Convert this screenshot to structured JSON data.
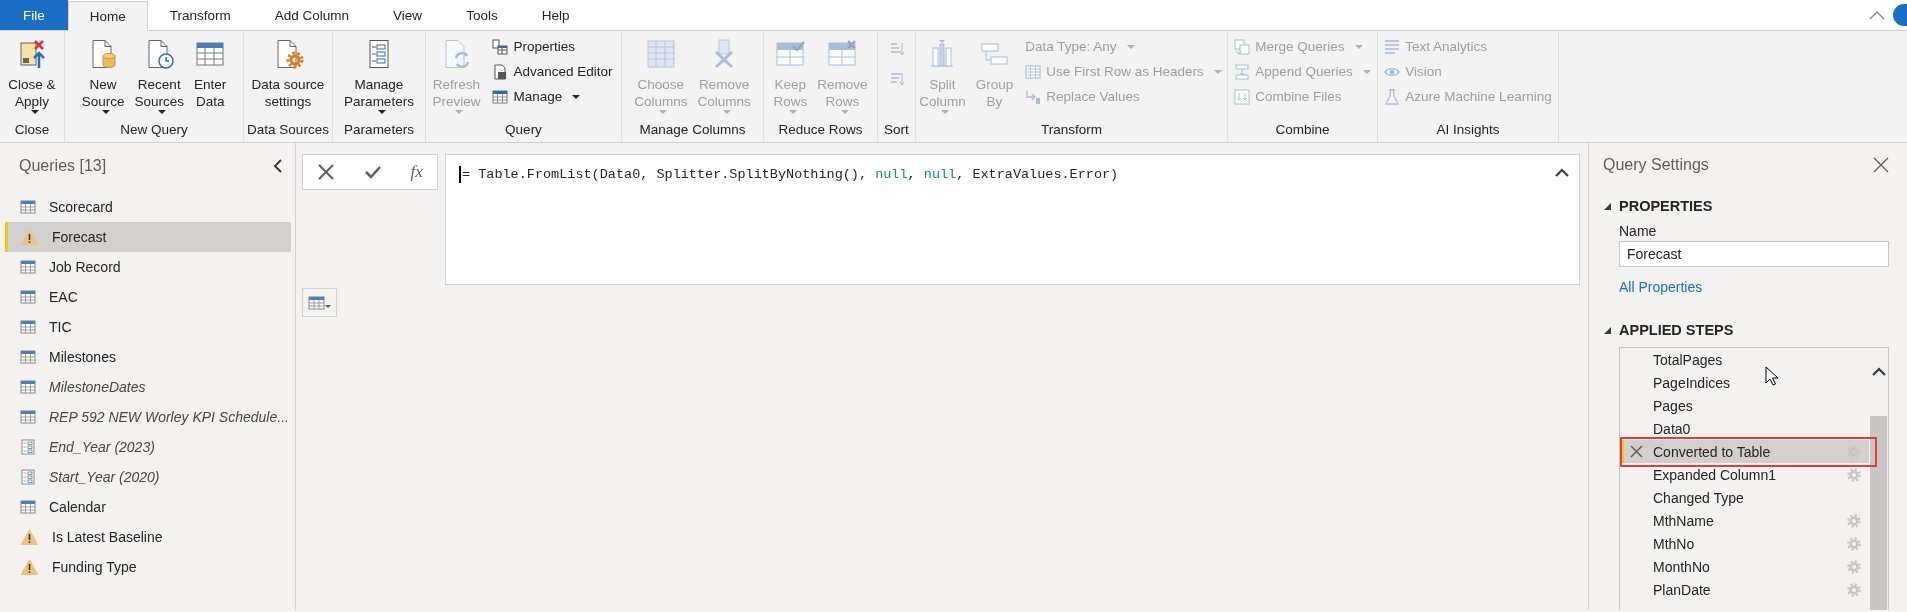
{
  "tabs": [
    {
      "label": "File",
      "kind": "file",
      "selected": false
    },
    {
      "label": "Home",
      "kind": "tab",
      "selected": true
    },
    {
      "label": "Transform",
      "kind": "tab",
      "selected": false
    },
    {
      "label": "Add Column",
      "kind": "tab",
      "selected": false
    },
    {
      "label": "View",
      "kind": "tab",
      "selected": false
    },
    {
      "label": "Tools",
      "kind": "tab",
      "selected": false
    },
    {
      "label": "Help",
      "kind": "tab",
      "selected": false
    }
  ],
  "ribbon": {
    "groups": [
      {
        "label": "Close",
        "items": [
          {
            "kind": "large",
            "label": "Close &\nApply",
            "dropdown": true,
            "disabled": false
          }
        ]
      },
      {
        "label": "New Query",
        "items": [
          {
            "kind": "large",
            "label": "New\nSource",
            "dropdown": true,
            "disabled": false
          },
          {
            "kind": "large",
            "label": "Recent\nSources",
            "dropdown": true,
            "disabled": false
          },
          {
            "kind": "large",
            "label": "Enter\nData",
            "dropdown": false,
            "disabled": false
          }
        ]
      },
      {
        "label": "Data Sources",
        "items": [
          {
            "kind": "large",
            "label": "Data source\nsettings",
            "dropdown": false,
            "disabled": false
          }
        ]
      },
      {
        "label": "Parameters",
        "items": [
          {
            "kind": "large",
            "label": "Manage\nParameters",
            "dropdown": true,
            "disabled": false
          }
        ]
      },
      {
        "label": "Query",
        "items": [
          {
            "kind": "large",
            "label": "Refresh\nPreview",
            "dropdown": true,
            "disabled": true
          },
          {
            "kind": "small",
            "label": "Properties",
            "dropdown": false,
            "disabled": false
          },
          {
            "kind": "small",
            "label": "Advanced Editor",
            "dropdown": false,
            "disabled": false
          },
          {
            "kind": "small",
            "label": "Manage",
            "dropdown": true,
            "disabled": false
          }
        ]
      },
      {
        "label": "Manage Columns",
        "items": [
          {
            "kind": "large",
            "label": "Choose\nColumns",
            "dropdown": true,
            "disabled": true
          },
          {
            "kind": "large",
            "label": "Remove\nColumns",
            "dropdown": true,
            "disabled": true
          }
        ]
      },
      {
        "label": "Reduce Rows",
        "items": [
          {
            "kind": "large",
            "label": "Keep\nRows",
            "dropdown": true,
            "disabled": true
          },
          {
            "kind": "large",
            "label": "Remove\nRows",
            "dropdown": true,
            "disabled": true
          }
        ]
      },
      {
        "label": "Sort",
        "items": [
          {
            "kind": "icon",
            "disabled": true
          },
          {
            "kind": "icon",
            "disabled": true
          }
        ]
      },
      {
        "label": "Transform",
        "items": [
          {
            "kind": "large",
            "label": "Split\nColumn",
            "dropdown": true,
            "disabled": true
          },
          {
            "kind": "large",
            "label": "Group\nBy",
            "dropdown": false,
            "disabled": true
          },
          {
            "kind": "small",
            "label": "Data Type: Any",
            "dropdown": true,
            "disabled": true
          },
          {
            "kind": "small",
            "label": "Use First Row as Headers",
            "dropdown": true,
            "disabled": true
          },
          {
            "kind": "small",
            "label": "Replace Values",
            "dropdown": false,
            "disabled": true
          }
        ]
      },
      {
        "label": "Combine",
        "items": [
          {
            "kind": "small",
            "label": "Merge Queries",
            "dropdown": true,
            "disabled": true
          },
          {
            "kind": "small",
            "label": "Append Queries",
            "dropdown": true,
            "disabled": true
          },
          {
            "kind": "small",
            "label": "Combine Files",
            "dropdown": false,
            "disabled": true
          }
        ]
      },
      {
        "label": "AI Insights",
        "items": [
          {
            "kind": "small",
            "label": "Text Analytics",
            "dropdown": false,
            "disabled": true
          },
          {
            "kind": "small",
            "label": "Vision",
            "dropdown": false,
            "disabled": true
          },
          {
            "kind": "small",
            "label": "Azure Machine Learning",
            "dropdown": false,
            "disabled": true
          }
        ]
      }
    ]
  },
  "queries": {
    "title": "Queries [13]",
    "items": [
      {
        "name": "Scorecard",
        "kind": "table",
        "loaded": true,
        "selected": false
      },
      {
        "name": "Forecast",
        "kind": "warning",
        "loaded": true,
        "selected": true
      },
      {
        "name": "Job Record",
        "kind": "table",
        "loaded": true,
        "selected": false
      },
      {
        "name": "EAC",
        "kind": "table",
        "loaded": true,
        "selected": false
      },
      {
        "name": "TIC",
        "kind": "table",
        "loaded": true,
        "selected": false
      },
      {
        "name": "Milestones",
        "kind": "table",
        "loaded": true,
        "selected": false
      },
      {
        "name": "MilestoneDates",
        "kind": "table",
        "loaded": false,
        "selected": false
      },
      {
        "name": "REP 592 NEW Worley KPI Schedule...",
        "kind": "table",
        "loaded": false,
        "selected": false
      },
      {
        "name": "End_Year (2023)",
        "kind": "parameter",
        "loaded": false,
        "selected": false
      },
      {
        "name": "Start_Year (2020)",
        "kind": "parameter",
        "loaded": false,
        "selected": false
      },
      {
        "name": "Calendar",
        "kind": "table",
        "loaded": true,
        "selected": false
      },
      {
        "name": "Is Latest Baseline",
        "kind": "warning",
        "loaded": true,
        "selected": false
      },
      {
        "name": "Funding Type",
        "kind": "warning",
        "loaded": true,
        "selected": false
      }
    ]
  },
  "formula_bar": {
    "fx": "fx",
    "tokens": [
      {
        "text": "= Table.FromList(Data0, Splitter.SplitByNothing(), ",
        "kind": "plain"
      },
      {
        "text": "null",
        "kind": "constant"
      },
      {
        "text": ", ",
        "kind": "plain"
      },
      {
        "text": "null",
        "kind": "constant"
      },
      {
        "text": ", ExtraValues.Error)",
        "kind": "plain"
      }
    ]
  },
  "query_settings": {
    "title": "Query Settings",
    "properties": {
      "heading": "PROPERTIES",
      "expanded": true,
      "name_label": "Name",
      "name_value": "Forecast",
      "link": "All Properties"
    },
    "applied_steps": {
      "heading": "APPLIED STEPS",
      "expanded": true,
      "steps": [
        {
          "name": "TotalPages",
          "selected": false,
          "settings": false,
          "highlighted": false
        },
        {
          "name": "PageIndices",
          "selected": false,
          "settings": false,
          "highlighted": false
        },
        {
          "name": "Pages",
          "selected": false,
          "settings": false,
          "highlighted": false
        },
        {
          "name": "Data0",
          "selected": false,
          "settings": false,
          "highlighted": false
        },
        {
          "name": "Converted to Table",
          "selected": true,
          "settings": true,
          "highlighted": true
        },
        {
          "name": "Expanded Column1",
          "selected": false,
          "settings": true,
          "highlighted": false
        },
        {
          "name": "Changed Type",
          "selected": false,
          "settings": false,
          "highlighted": false
        },
        {
          "name": "MthName",
          "selected": false,
          "settings": true,
          "highlighted": false
        },
        {
          "name": "MthNo",
          "selected": false,
          "settings": true,
          "highlighted": false
        },
        {
          "name": "MonthNo",
          "selected": false,
          "settings": true,
          "highlighted": false
        },
        {
          "name": "PlanDate",
          "selected": false,
          "settings": true,
          "highlighted": false
        }
      ]
    }
  }
}
